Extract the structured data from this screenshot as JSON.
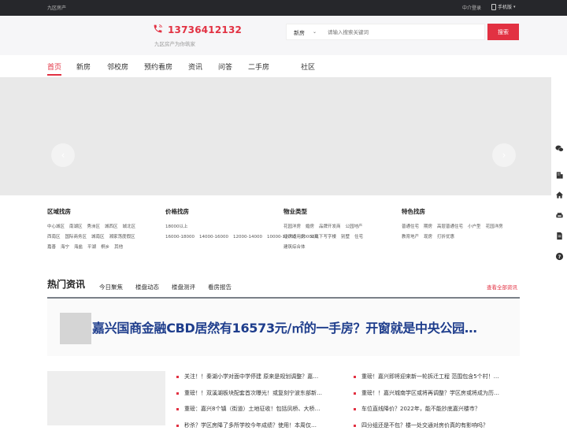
{
  "topbar": {
    "site_name": "九区房产",
    "login": "中介登录",
    "mobile": "手机版"
  },
  "header": {
    "hotline": "13736412132",
    "tagline": "九区房产为你筑家",
    "search": {
      "selected": "新房",
      "placeholder": "请输入搜索关键词",
      "button": "搜索"
    }
  },
  "nav": {
    "items": [
      "首页",
      "新房",
      "邻校房",
      "预约看房",
      "资讯",
      "问答",
      "二手房",
      "社区"
    ],
    "active": 0
  },
  "filters": [
    {
      "title": "区域找房",
      "links": [
        "中心城区",
        "南湖区",
        "秀洲区",
        "城西区",
        "城北区",
        "西南区",
        "国际商务区",
        "城南区",
        "湘家荡度假区",
        "嘉善",
        "海宁",
        "海盐",
        "平湖",
        "桐乡",
        "其他"
      ]
    },
    {
      "title": "价格找房",
      "links": [
        "18000以上",
        "16000-18000",
        "14000-16000",
        "12000-14000",
        "10000-12000",
        "10000以下"
      ]
    },
    {
      "title": "物业类型",
      "links": [
        "花园洋房",
        "婚房",
        "品牌开发商",
        "公园地产",
        "经济适用房",
        "公寓",
        "写字楼",
        "别墅",
        "住宅",
        "建筑综合体"
      ]
    },
    {
      "title": "特色找房",
      "links": [
        "普通住宅",
        "期房",
        "高层普通住宅",
        "小户型",
        "花园洋房",
        "教育地产",
        "现房",
        "打折优惠"
      ]
    }
  ],
  "hot": {
    "title": "热门资讯",
    "tabs": [
      "今日聚焦",
      "楼盘动态",
      "楼盘测评",
      "看房报告"
    ],
    "more": "查看全部资讯",
    "feature_headline": "嘉兴国商金融CBD居然有16573元/㎡的一手房？开窗就是中央公园…",
    "news_left": [
      "关注！！秦湖小学对面中学停建 原来是规划调整？嘉…",
      "重磅！！双溪湖板块配套首次曝光！或复刻宁波东部新…",
      "重磅：嘉兴8个镇（街道）土地征收！包括凤桥、大桥…",
      "秒杀？学区房降了多所学校今年成绩？使用！本周仅…"
    ],
    "news_right": [
      "重磅！嘉兴即将迎来新一轮拆迁工程 范围包含5个村！…",
      "重磅！！嘉兴城南学区或将再调整？学区房或将成为历…",
      "车位直线降价？2022年，能不能抄底嘉兴楼市？",
      "四分组还是不包？楼一处交通对房价真的有影响吗？"
    ]
  },
  "colors": {
    "accent": "#e23142",
    "headline": "#1e3d8c",
    "topbar": "#26272b"
  }
}
